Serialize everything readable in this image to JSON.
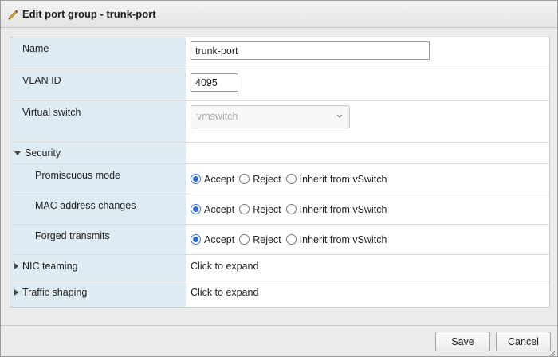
{
  "dialog": {
    "title": "Edit port group - trunk-port",
    "title_icon": "pencil-icon"
  },
  "form": {
    "name": {
      "label": "Name",
      "value": "trunk-port"
    },
    "vlan": {
      "label": "VLAN ID",
      "value": "4095"
    },
    "vswitch": {
      "label": "Virtual switch",
      "selected": "vmswitch"
    },
    "security": {
      "label": "Security",
      "expanded": true,
      "rows": [
        {
          "label": "Promiscuous mode",
          "options": [
            "Accept",
            "Reject",
            "Inherit from vSwitch"
          ],
          "selected": "Accept"
        },
        {
          "label": "MAC address changes",
          "options": [
            "Accept",
            "Reject",
            "Inherit from vSwitch"
          ],
          "selected": "Accept"
        },
        {
          "label": "Forged transmits",
          "options": [
            "Accept",
            "Reject",
            "Inherit from vSwitch"
          ],
          "selected": "Accept"
        }
      ]
    },
    "nic_teaming": {
      "label": "NIC teaming",
      "value": "Click to expand",
      "expanded": false
    },
    "traffic_shaping": {
      "label": "Traffic shaping",
      "value": "Click to expand",
      "expanded": false
    }
  },
  "buttons": {
    "save": "Save",
    "cancel": "Cancel"
  },
  "colors": {
    "label_bg": "#dfebf2",
    "radio_selected": "#2c6bd6",
    "pencil": "#d8a020"
  }
}
